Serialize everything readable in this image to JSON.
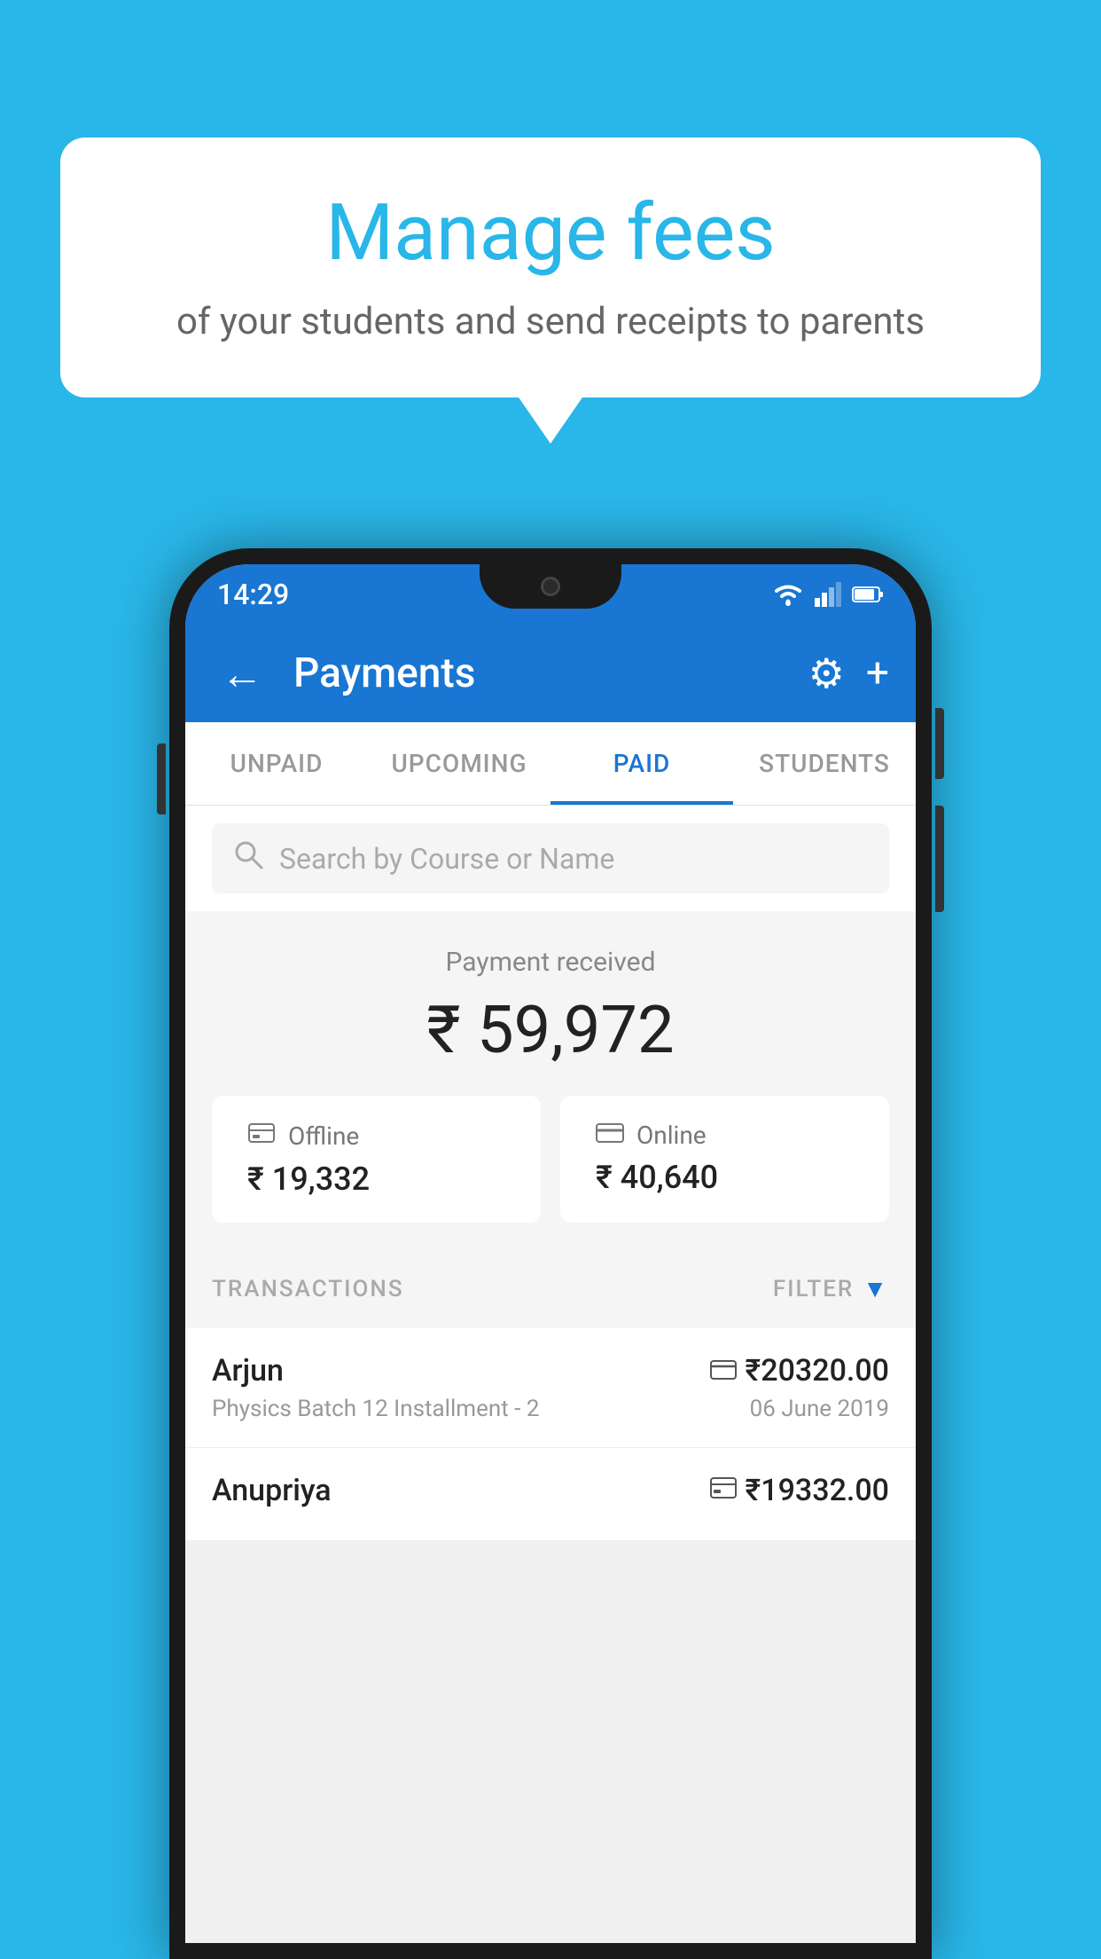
{
  "background_color": "#29b6e8",
  "speech_bubble": {
    "title": "Manage fees",
    "subtitle": "of your students and send receipts to parents"
  },
  "status_bar": {
    "time": "14:29"
  },
  "app_bar": {
    "title": "Payments",
    "back_label": "←",
    "gear_label": "⚙",
    "plus_label": "+"
  },
  "tabs": [
    {
      "label": "UNPAID",
      "active": false
    },
    {
      "label": "UPCOMING",
      "active": false
    },
    {
      "label": "PAID",
      "active": true
    },
    {
      "label": "STUDENTS",
      "active": false
    }
  ],
  "search": {
    "placeholder": "Search by Course or Name"
  },
  "payment_summary": {
    "label": "Payment received",
    "amount": "₹ 59,972",
    "offline": {
      "icon": "💳",
      "label": "Offline",
      "amount": "₹ 19,332"
    },
    "online": {
      "icon": "💳",
      "label": "Online",
      "amount": "₹ 40,640"
    }
  },
  "transactions": {
    "header_label": "TRANSACTIONS",
    "filter_label": "FILTER",
    "rows": [
      {
        "name": "Arjun",
        "description": "Physics Batch 12 Installment - 2",
        "amount": "₹20320.00",
        "date": "06 June 2019",
        "type": "online"
      },
      {
        "name": "Anupriya",
        "description": "",
        "amount": "₹19332.00",
        "date": "",
        "type": "offline"
      }
    ]
  }
}
